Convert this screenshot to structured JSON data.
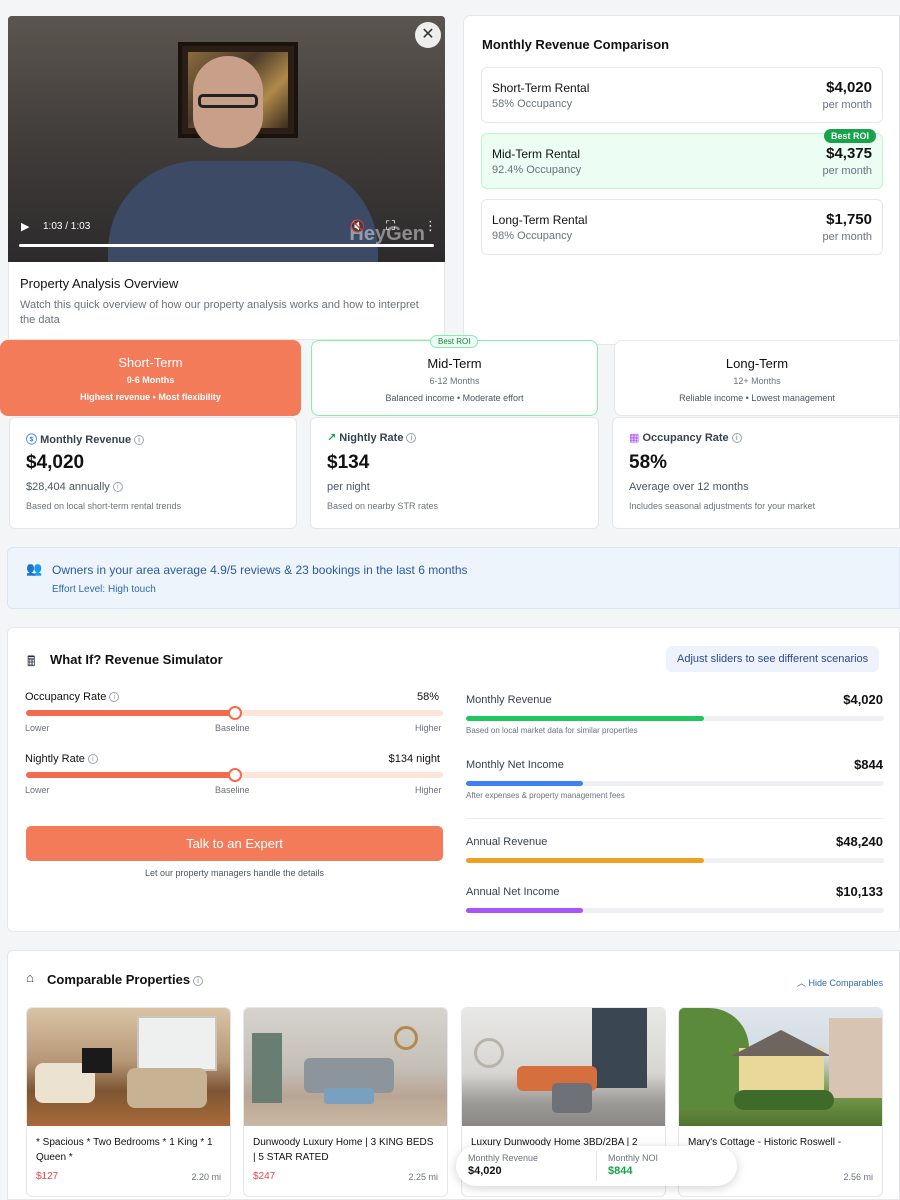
{
  "video": {
    "time": "1:03 / 1:03",
    "watermark": "HeyGen",
    "progress": 1.0
  },
  "overview": {
    "title": "Property Analysis Overview",
    "description": "Watch this quick overview of how our property analysis works and how to interpret the data"
  },
  "comparison": {
    "title": "Monthly Revenue Comparison",
    "items": [
      {
        "name": "Short-Term Rental",
        "occupancy": "58% Occupancy",
        "amount": "$4,020",
        "period": "per month"
      },
      {
        "name": "Mid-Term Rental",
        "occupancy": "92.4% Occupancy",
        "amount": "$4,375",
        "period": "per month",
        "badge": "Best ROI"
      },
      {
        "name": "Long-Term Rental",
        "occupancy": "98% Occupancy",
        "amount": "$1,750",
        "period": "per month"
      }
    ]
  },
  "terms": [
    {
      "title": "Short-Term",
      "range": "0-6 Months",
      "desc": "Highest revenue • Most flexibility"
    },
    {
      "title": "Mid-Term",
      "range": "6-12 Months",
      "desc": "Balanced income • Moderate effort",
      "badge": "Best ROI"
    },
    {
      "title": "Long-Term",
      "range": "12+ Months",
      "desc": "Reliable income • Lowest management"
    }
  ],
  "metrics": [
    {
      "label": "Monthly Revenue",
      "value": "$4,020",
      "detail": "$28,404 annually",
      "note": "Based on local short-term rental trends"
    },
    {
      "label": "Nightly Rate",
      "value": "$134",
      "detail": "per night",
      "note": "Based on nearby STR rates"
    },
    {
      "label": "Occupancy Rate",
      "value": "58%",
      "detail": "Average over 12 months",
      "note": "Includes seasonal adjustments for your market"
    }
  ],
  "banner": {
    "text": "Owners in your area average 4.9/5 reviews & 23 bookings in the last 6 months",
    "effort_label": "Effort Level:",
    "effort_value": "High touch"
  },
  "simulator": {
    "title": "What If? Revenue Simulator",
    "hint": "Adjust sliders to see different scenarios",
    "sliders": [
      {
        "label": "Occupancy Rate",
        "value": "58%",
        "position": 0.5,
        "low": "Lower",
        "mid": "Baseline",
        "high": "Higher"
      },
      {
        "label": "Nightly Rate",
        "value": "$134 night",
        "position": 0.5,
        "low": "Lower",
        "mid": "Baseline",
        "high": "Higher"
      }
    ],
    "cta": "Talk to an Expert",
    "cta_note": "Let our property managers handle the details",
    "results": [
      {
        "label": "Monthly Revenue",
        "value": "$4,020",
        "note": "Based on local market data for similar properties",
        "fill": 0.57,
        "color": "#22c55e"
      },
      {
        "label": "Monthly Net Income",
        "value": "$844",
        "note": "After expenses & property management fees",
        "fill": 0.28,
        "color": "#3b82f6"
      },
      {
        "label": "Annual Revenue",
        "value": "$48,240",
        "note": "",
        "fill": 0.57,
        "color": "#f0a020"
      },
      {
        "label": "Annual Net Income",
        "value": "$10,133",
        "note": "",
        "fill": 0.28,
        "color": "#a855f7"
      }
    ]
  },
  "comparables": {
    "title": "Comparable Properties",
    "toggle": "Hide Comparables",
    "items": [
      {
        "title": "* Spacious * Two Bedrooms * 1 King * 1 Queen *",
        "price": "$127",
        "distance": "2.20 mi"
      },
      {
        "title": "Dunwoody Luxury Home | 3 KING BEDS | 5 STAR RATED",
        "price": "$247",
        "distance": "2.25 mi"
      },
      {
        "title": "Luxury Dunwoody Home 3BD/2BA | 2",
        "price": "",
        "distance": ""
      },
      {
        "title": "Mary's Cottage - Historic Roswell -",
        "price": "",
        "distance": "2.56 mi"
      }
    ],
    "popup": {
      "rev_label": "Monthly Revenue",
      "rev_value": "$4,020",
      "noi_label": "Monthly NOI",
      "noi_value": "$844"
    }
  }
}
